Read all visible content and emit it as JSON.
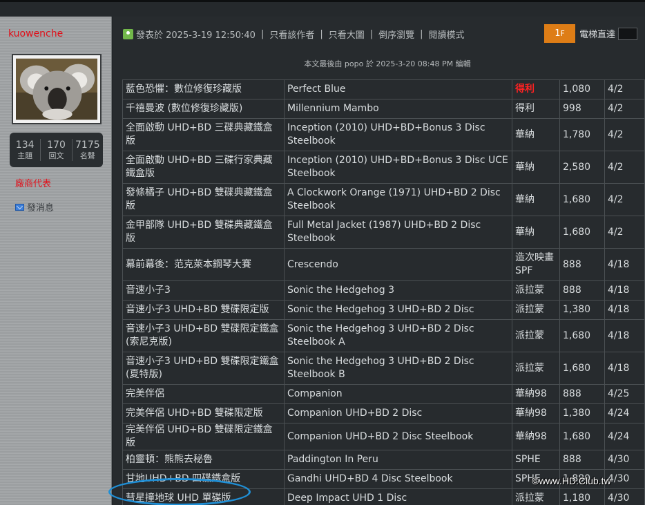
{
  "sidebar": {
    "username": "kuowenche",
    "stats": [
      {
        "value": "134",
        "label": "主題"
      },
      {
        "value": "170",
        "label": "回文"
      },
      {
        "value": "7175",
        "label": "名聲"
      }
    ],
    "vendor_label": "廠商代表",
    "message_label": "發消息"
  },
  "post": {
    "posted_at": "發表於 2025-3-19 12:50:40",
    "links": [
      "只看該作者",
      "只看大圖",
      "倒序瀏覽",
      "閱讀模式"
    ],
    "floor": "1",
    "floor_sup": "F",
    "elevator_label": "電梯直達",
    "edit_note": "本文最後由 popo 於 2025-3-20 08:48 PM 編輯"
  },
  "table": {
    "rows": [
      {
        "cn": "藍色恐懼：數位修復珍藏版",
        "en": "Perfect Blue",
        "dist": "得利",
        "price": "1,080",
        "date": "4/2",
        "highlight": true
      },
      {
        "cn": "千禧曼波 (數位修復珍藏版)",
        "en": "Millennium  Mambo",
        "dist": "得利",
        "price": "998",
        "date": "4/2"
      },
      {
        "cn": "全面啟動  UHD+BD 三碟典藏鐵盒版",
        "en": "Inception  (2010) UHD+BD+Bonus 3 Disc Steelbook",
        "dist": "華納",
        "price": "1,780",
        "date": "4/2"
      },
      {
        "cn": "全面啟動  UHD+BD 三碟行家典藏鐵盒版",
        "en": "Inception  (2010) UHD+BD+Bonus 3 Disc UCE Steelbook",
        "dist": "華納",
        "price": "2,580",
        "date": "4/2"
      },
      {
        "cn": "發條橘子  UHD+BD 雙碟典藏鐵盒版",
        "en": "A Clockwork  Orange (1971) UHD+BD 2 Disc Steelbook",
        "dist": "華納",
        "price": "1,680",
        "date": "4/2"
      },
      {
        "cn": "金甲部隊 UHD+BD 雙碟典藏鐵盒版",
        "en": "Full  Metal Jacket (1987) UHD+BD 2 Disc Steelbook",
        "dist": "華納",
        "price": "1,680",
        "date": "4/2"
      },
      {
        "cn": "幕前幕後：范克萊本鋼琴大賽",
        "en": "Crescendo",
        "dist": "造次映畫SPF",
        "price": "888",
        "date": "4/18"
      },
      {
        "cn": "音速小子3",
        "en": "Sonic the  Hedgehog 3",
        "dist": "派拉蒙",
        "price": "888",
        "date": "4/18"
      },
      {
        "cn": "音速小子3  UHD+BD 雙碟限定版",
        "en": "Sonic  the Hedgehog 3 UHD+BD 2 Disc",
        "dist": "派拉蒙",
        "price": "1,380",
        "date": "4/18"
      },
      {
        "cn": "音速小子3  UHD+BD 雙碟限定鐵盒(索尼克版)",
        "en": "Sonic the  Hedgehog 3 UHD+BD 2 Disc Steelbook A",
        "dist": "派拉蒙",
        "price": "1,680",
        "date": "4/18"
      },
      {
        "cn": "音速小子3  UHD+BD 雙碟限定鐵盒(夏特版)",
        "en": "Sonic the  Hedgehog 3 UHD+BD 2 Disc Steelbook B",
        "dist": "派拉蒙",
        "price": "1,680",
        "date": "4/18"
      },
      {
        "cn": "完美伴侶",
        "en": "Companion",
        "dist": "華納98",
        "price": "888",
        "date": "4/25"
      },
      {
        "cn": "完美伴侶  UHD+BD 雙碟限定版",
        "en": "Companion  UHD+BD 2 Disc",
        "dist": "華納98",
        "price": "1,380",
        "date": "4/24"
      },
      {
        "cn": "完美伴侶 UHD+BD 雙碟限定鐵盒版",
        "en": "Companion  UHD+BD 2 Disc  Steelbook",
        "dist": "華納98",
        "price": "1,680",
        "date": "4/24"
      },
      {
        "cn": "柏靈頓：熊熊去秘魯",
        "en": "Paddington In  Peru",
        "dist": "SPHE",
        "price": "888",
        "date": "4/30"
      },
      {
        "cn": "甘地UHD+BD  四碟鐵盒版",
        "en": "Gandhi UHD+BD 4  Disc Steelbook",
        "dist": "SPHE",
        "price": "1,880",
        "date": "4/30"
      },
      {
        "cn": "彗星撞地球  UHD 單碟版",
        "en": "Deep  Impact  UHD 1 Disc",
        "dist": "派拉蒙",
        "price": "1,180",
        "date": "4/30"
      }
    ]
  },
  "watermark": "©www.HD.Club.tw",
  "colors": {
    "accent_orange": "#de7d16",
    "red": "#e0101a",
    "circle_blue": "#1f8fd6"
  },
  "icons": [
    "koala-avatar",
    "user-icon",
    "mail-icon"
  ]
}
